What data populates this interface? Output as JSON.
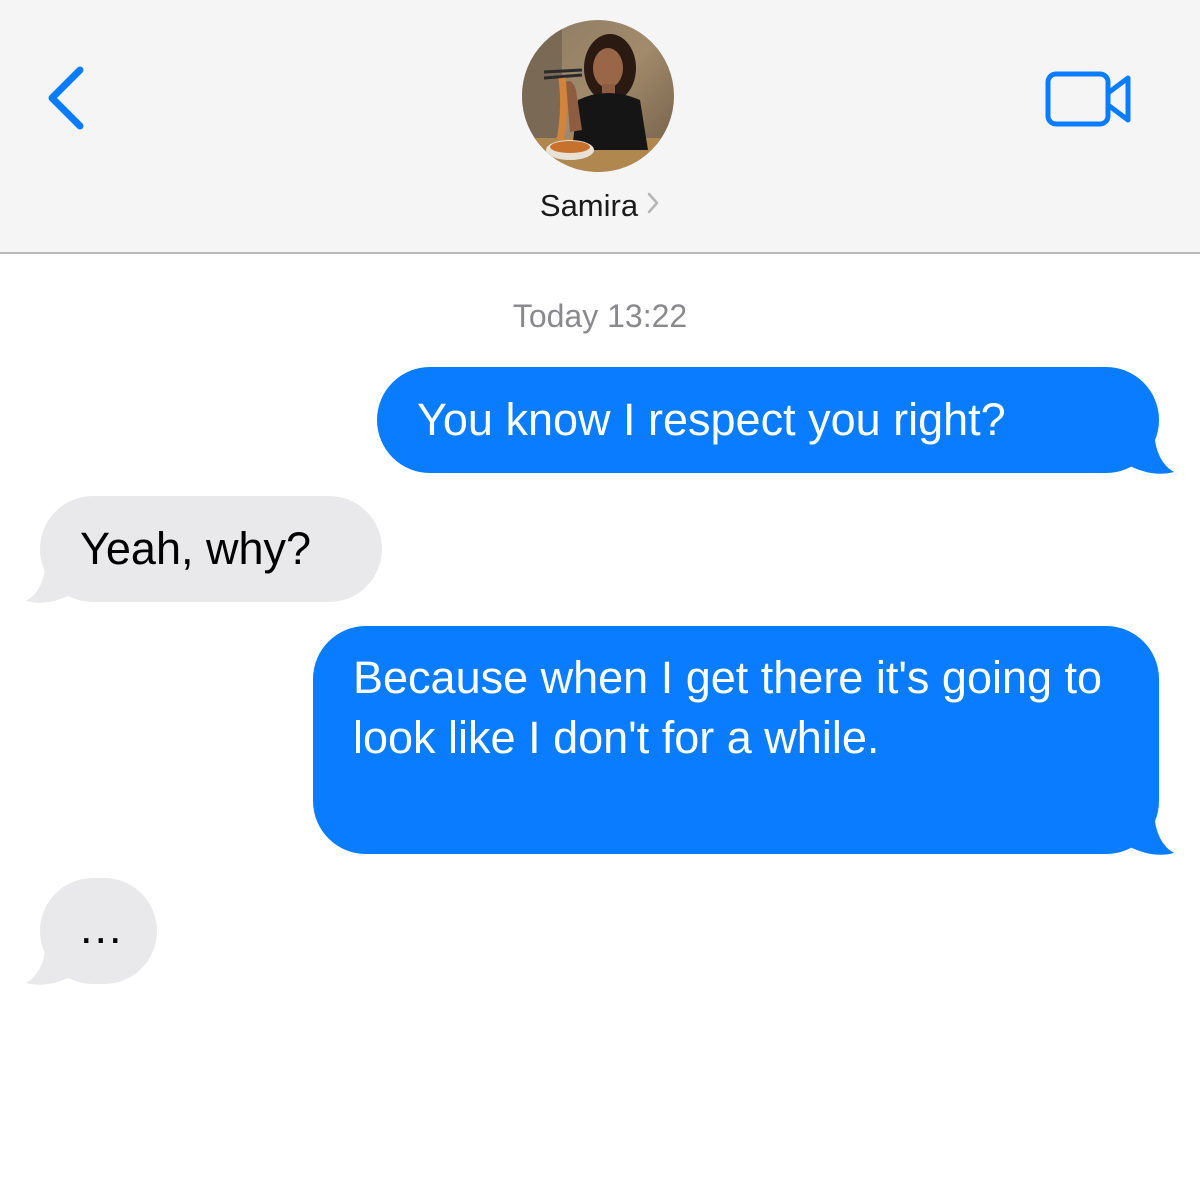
{
  "header": {
    "contact_name": "Samira",
    "back_icon": "chevron-left-icon",
    "video_icon": "video-camera-icon",
    "contact_chevron_icon": "chevron-right-icon",
    "accent_color": "#0a7cff"
  },
  "conversation": {
    "timestamp": "Today 13:22",
    "messages": [
      {
        "direction": "sent",
        "text": "You know I respect you right?"
      },
      {
        "direction": "received",
        "text": "Yeah, why?"
      },
      {
        "direction": "sent",
        "text": "Because when I get there it's going to look like I don't for a while."
      },
      {
        "direction": "received",
        "text": "..."
      }
    ]
  },
  "colors": {
    "sent_bubble": "#0a7cff",
    "received_bubble": "#e9e9eb",
    "header_background": "#f5f5f5"
  }
}
